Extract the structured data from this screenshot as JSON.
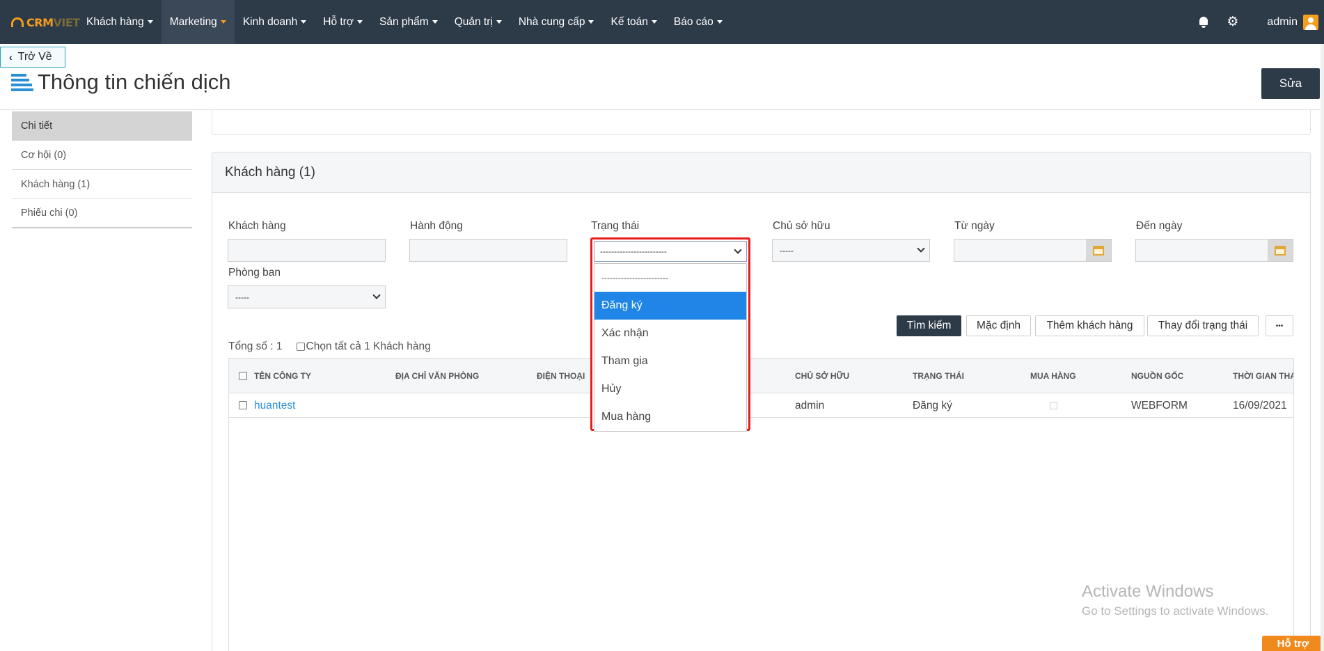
{
  "brand": {
    "logo_main": "CRM",
    "logo_dim": "VIET"
  },
  "nav": {
    "items": [
      {
        "label": "Khách hàng"
      },
      {
        "label": "Marketing"
      },
      {
        "label": "Kinh doanh"
      },
      {
        "label": "Hỗ trợ"
      },
      {
        "label": "Sản phẩm"
      },
      {
        "label": "Quản trị"
      },
      {
        "label": "Nhà cung cấp"
      },
      {
        "label": "Kế toán"
      },
      {
        "label": "Báo cáo"
      }
    ],
    "user": "admin"
  },
  "header": {
    "back_label": "Trở Về",
    "title": "Thông tin chiến dịch",
    "edit_label": "Sửa"
  },
  "sidebar": {
    "items": [
      {
        "label": "Chi tiết"
      },
      {
        "label": "Cơ hội (0)"
      },
      {
        "label": "Khách hàng (1)"
      },
      {
        "label": "Phiếu chi (0)"
      }
    ]
  },
  "panel": {
    "title": "Khách hàng (1)"
  },
  "filters": {
    "customer_label": "Khách hàng",
    "action_label": "Hành động",
    "status_label": "Trạng thái",
    "status_value": "------------------------",
    "owner_label": "Chủ sở hữu",
    "owner_value": "-----",
    "from_label": "Từ ngày",
    "to_label": "Đến ngày",
    "dept_label": "Phòng ban",
    "dept_value": "-----"
  },
  "status_dropdown": {
    "options": [
      "------------------------",
      "Đăng ký",
      "Xác nhận",
      "Tham gia",
      "Hủy",
      "Mua hàng"
    ],
    "selected": "Đăng ký"
  },
  "actions": {
    "search": "Tìm kiếm",
    "default": "Mặc định",
    "add_customer": "Thêm khách hàng",
    "change_status": "Thay đổi trạng thái",
    "more": "•••"
  },
  "summary": {
    "total": "Tổng số : 1",
    "select_all": "Chọn tất cả 1 Khách hàng"
  },
  "table": {
    "columns": [
      "TÊN CÔNG TY",
      "ĐỊA CHỈ VĂN PHÒNG",
      "ĐIỆN THOẠI",
      "CHỦ SỞ HỮU",
      "TRẠNG THÁI",
      "MUA HÀNG",
      "NGUỒN GỐC",
      "THỜI GIAN THA"
    ],
    "rows": [
      {
        "company": "huantest",
        "address": "",
        "phone": "",
        "owner": "admin",
        "status": "Đăng ký",
        "source": "WEBFORM",
        "time": "16/09/2021"
      }
    ]
  },
  "watermark": {
    "line1": "Activate Windows",
    "line2": "Go to Settings to activate Windows."
  },
  "support": {
    "label": "Hỗ trợ"
  }
}
